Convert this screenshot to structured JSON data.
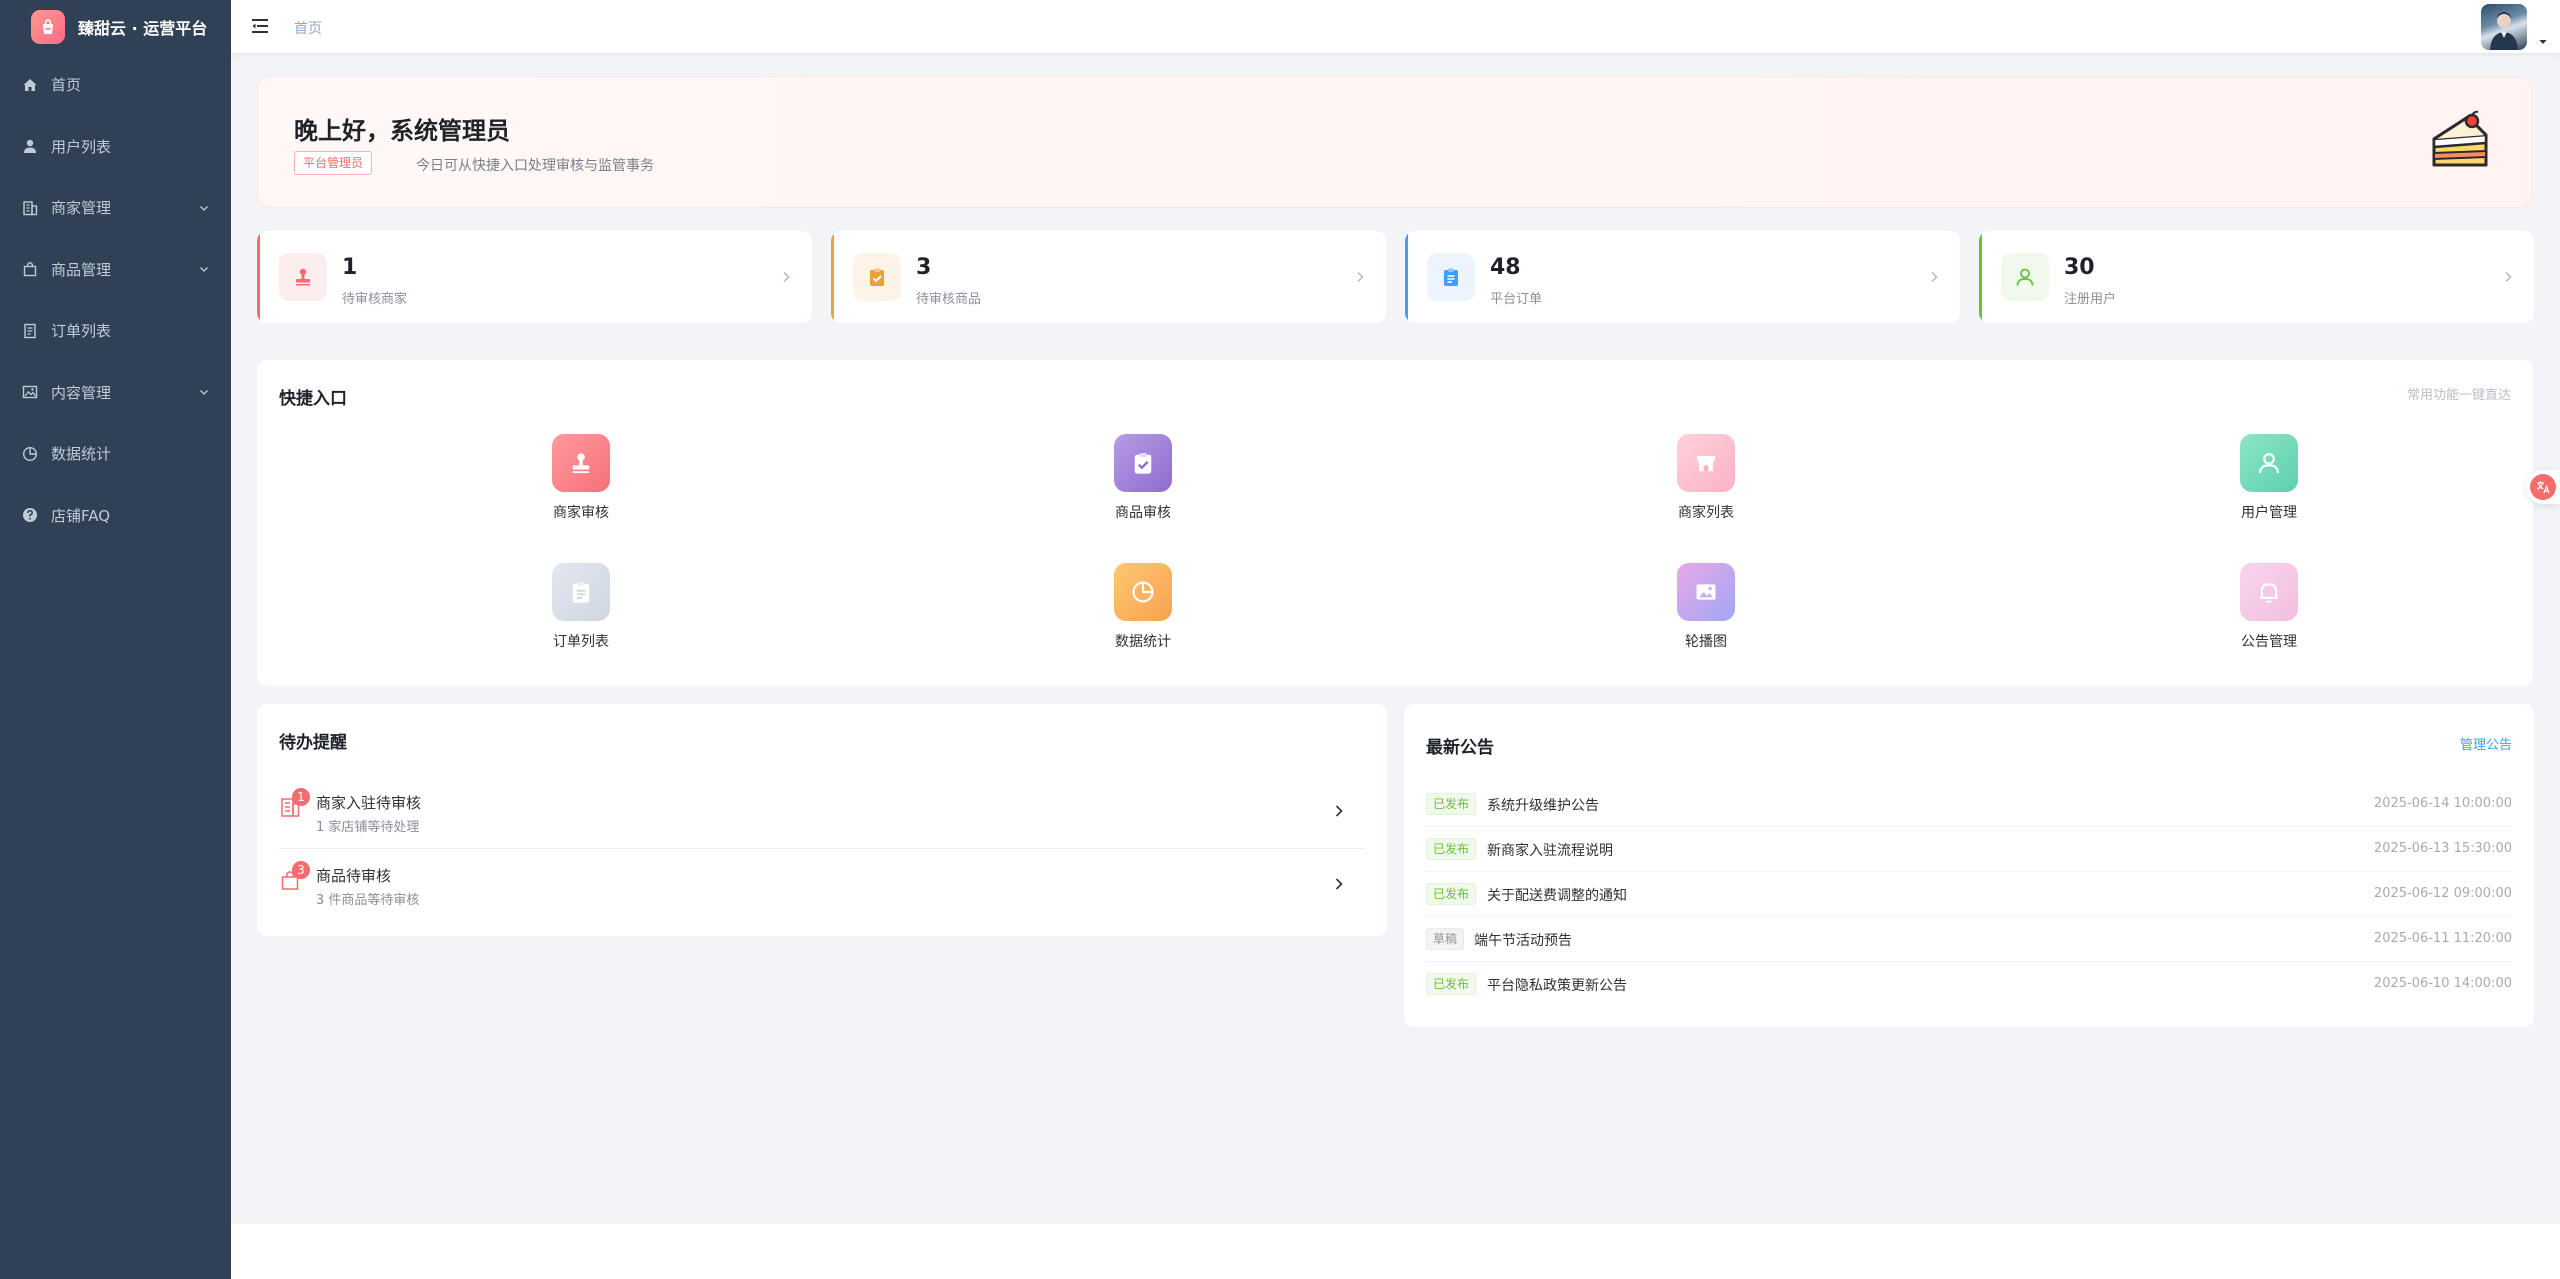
{
  "brand": {
    "title": "臻甜云 · 运营平台"
  },
  "sidebar": {
    "items": [
      {
        "label": "首页",
        "icon": "home-icon",
        "expandable": false
      },
      {
        "label": "用户列表",
        "icon": "user-icon",
        "expandable": false
      },
      {
        "label": "商家管理",
        "icon": "building-icon",
        "expandable": true
      },
      {
        "label": "商品管理",
        "icon": "bag-icon",
        "expandable": true
      },
      {
        "label": "订单列表",
        "icon": "document-icon",
        "expandable": false
      },
      {
        "label": "内容管理",
        "icon": "image-icon",
        "expandable": true
      },
      {
        "label": "数据统计",
        "icon": "pie-chart-icon",
        "expandable": false
      },
      {
        "label": "店铺FAQ",
        "icon": "question-icon",
        "expandable": false
      }
    ]
  },
  "header": {
    "breadcrumb": "首页"
  },
  "welcome": {
    "greeting": "晚上好，系统管理员",
    "role_tag": "平台管理员",
    "subtitle": "今日可从快捷入口处理审核与监管事务"
  },
  "stats": [
    {
      "value": "1",
      "label": "待审核商家",
      "accent": "#f56c6c",
      "icon": "stamp-icon"
    },
    {
      "value": "3",
      "label": "待审核商品",
      "accent": "#e6a23c",
      "icon": "clipboard-check-icon"
    },
    {
      "value": "48",
      "label": "平台订单",
      "accent": "#409eff",
      "icon": "clipboard-icon"
    },
    {
      "value": "30",
      "label": "注册用户",
      "accent": "#67c23a",
      "icon": "user-icon"
    }
  ],
  "quick": {
    "title": "快捷入口",
    "hint": "常用功能一键直达",
    "items": [
      {
        "label": "商家审核",
        "icon": "stamp-icon"
      },
      {
        "label": "商品审核",
        "icon": "clipboard-check-icon"
      },
      {
        "label": "商家列表",
        "icon": "shop-icon"
      },
      {
        "label": "用户管理",
        "icon": "user-icon"
      },
      {
        "label": "订单列表",
        "icon": "clipboard-icon"
      },
      {
        "label": "数据统计",
        "icon": "pie-chart-icon"
      },
      {
        "label": "轮播图",
        "icon": "image-icon"
      },
      {
        "label": "公告管理",
        "icon": "bell-icon"
      }
    ]
  },
  "todo": {
    "title": "待办提醒",
    "items": [
      {
        "badge": "1",
        "title": "商家入驻待审核",
        "sub": "1 家店铺等待处理",
        "icon": "building-icon"
      },
      {
        "badge": "3",
        "title": "商品待审核",
        "sub": "3 件商品等待审核",
        "icon": "bag-icon"
      }
    ]
  },
  "notice": {
    "title": "最新公告",
    "manage_label": "管理公告",
    "items": [
      {
        "status": "已发布",
        "published": true,
        "title": "系统升级维护公告",
        "date": "2025-06-14 10:00:00"
      },
      {
        "status": "已发布",
        "published": true,
        "title": "新商家入驻流程说明",
        "date": "2025-06-13 15:30:00"
      },
      {
        "status": "已发布",
        "published": true,
        "title": "关于配送费调整的通知",
        "date": "2025-06-12 09:00:00"
      },
      {
        "status": "草稿",
        "published": false,
        "title": "端午节活动预告",
        "date": "2025-06-11 11:20:00"
      },
      {
        "status": "已发布",
        "published": true,
        "title": "平台隐私政策更新公告",
        "date": "2025-06-10 14:00:00"
      }
    ]
  }
}
